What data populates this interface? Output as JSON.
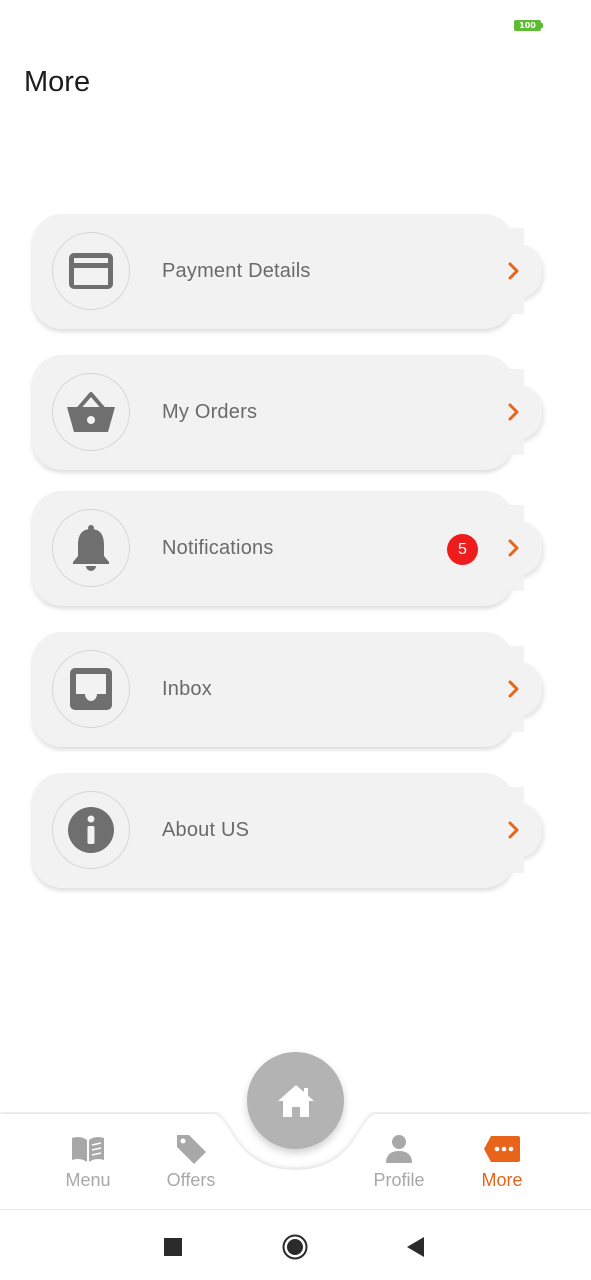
{
  "status_bar": {
    "battery": "100",
    "battery_color": "#5dbb34"
  },
  "header": {
    "title": "More"
  },
  "menu": {
    "items": [
      {
        "label": "Payment Details",
        "icon": "credit-card-icon",
        "badge": ""
      },
      {
        "label": "My Orders",
        "icon": "basket-icon",
        "badge": ""
      },
      {
        "label": "Notifications",
        "icon": "bell-icon",
        "badge": "5"
      },
      {
        "label": "Inbox",
        "icon": "inbox-icon",
        "badge": ""
      },
      {
        "label": "About US",
        "icon": "info-icon",
        "badge": ""
      }
    ]
  },
  "bottom_nav": {
    "items": [
      {
        "label": "Menu",
        "icon": "menu-book-icon",
        "active": false
      },
      {
        "label": "Offers",
        "icon": "tag-icon",
        "active": false
      },
      {
        "label": "Profile",
        "icon": "person-icon",
        "active": false
      },
      {
        "label": "More",
        "icon": "more-dots-icon",
        "active": true
      }
    ],
    "home_icon": "home-icon"
  },
  "system_nav": {
    "buttons": [
      "recents-square-icon",
      "home-circle-icon",
      "back-triangle-icon"
    ]
  },
  "colors": {
    "accent": "#e8641a",
    "badge": "#ee1c1c",
    "card_bg": "#f2f2f2",
    "icon_gray": "#6f6f6f",
    "inactive_nav": "#a8a8a8",
    "fab": "#b3b3b3"
  }
}
